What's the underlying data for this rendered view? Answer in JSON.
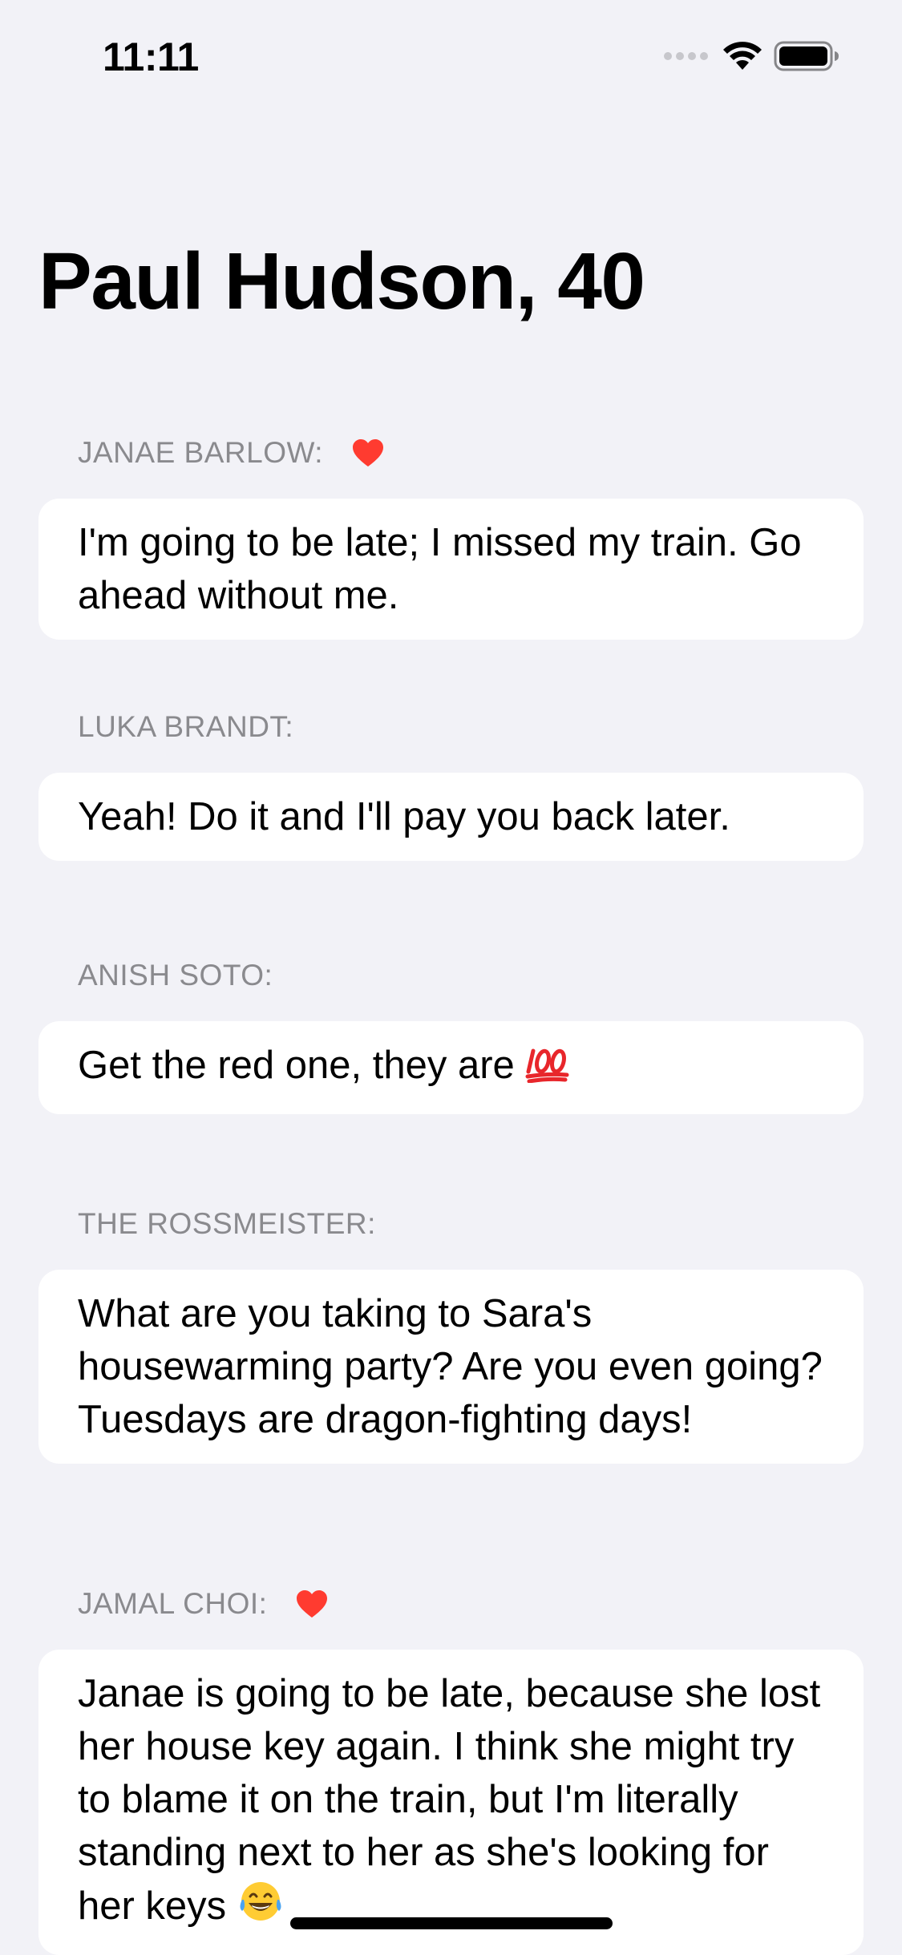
{
  "status_bar": {
    "time": "11:11"
  },
  "page": {
    "title": "Paul Hudson, 40"
  },
  "messages": [
    {
      "sender": "JANAE BARLOW:",
      "favorite": true,
      "text": "I'm going to be late; I missed my train. Go ahead without me."
    },
    {
      "sender": "LUKA BRANDT:",
      "favorite": false,
      "text": "Yeah! Do it and I'll pay you back later."
    },
    {
      "sender": "ANISH SOTO:",
      "favorite": false,
      "text": "Get the red one, they are",
      "emoji": "hundred-points-icon"
    },
    {
      "sender": "THE ROSSMEISTER:",
      "favorite": false,
      "text": "What are you taking to Sara's housewarming party? Are you even going? Tuesdays are dragon-fighting days!"
    },
    {
      "sender": "JAMAL CHOI:",
      "favorite": true,
      "text": "Janae is going to be late, because she lost her house key again. I think she might try to blame it on the train, but I'm literally standing next to her as she's looking for her keys",
      "emoji": "tears-of-joy-icon"
    }
  ],
  "colors": {
    "background": "#f2f2f7",
    "card": "#ffffff",
    "header_text": "#8a8a8e",
    "heart": "#ff3b30"
  }
}
